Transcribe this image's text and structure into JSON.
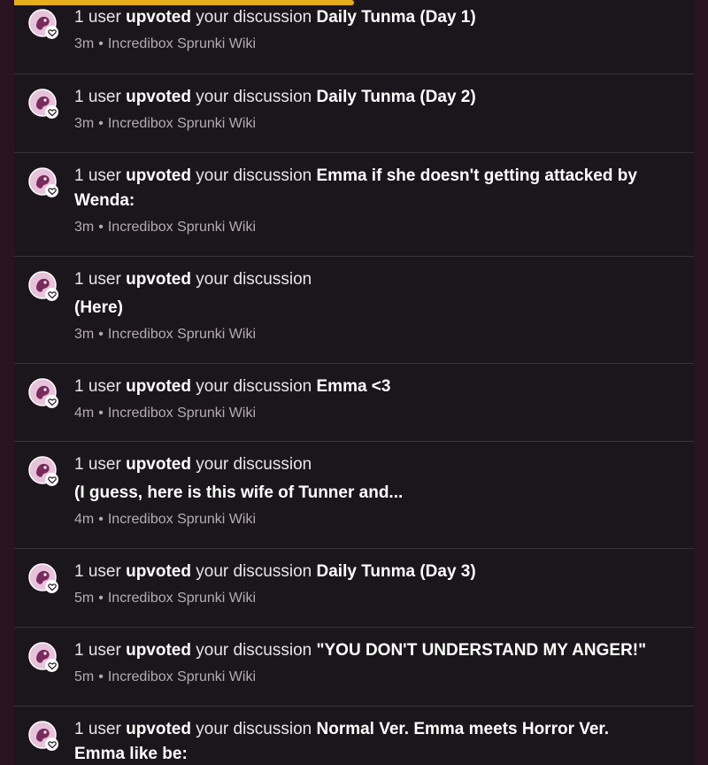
{
  "colors": {
    "background": "#2a1320",
    "panel": "#1b161b",
    "divider": "#3a3339",
    "progress": "#e6ad1c",
    "avatar_bg": "#e6c3da",
    "avatar_fg": "#7a2a5c"
  },
  "progress": {
    "fraction": 0.5
  },
  "notifications": [
    {
      "count": "1 user",
      "action": "upvoted",
      "middle": "your discussion",
      "title": "Daily Tunma (Day 1)",
      "title_on_new_line": false,
      "time": "3m",
      "separator": "•",
      "source": "Incredibox Sprunki Wiki"
    },
    {
      "count": "1 user",
      "action": "upvoted",
      "middle": "your discussion",
      "title": "Daily Tunma (Day 2)",
      "title_on_new_line": false,
      "time": "3m",
      "separator": "•",
      "source": "Incredibox Sprunki Wiki"
    },
    {
      "count": "1 user",
      "action": "upvoted",
      "middle": "your discussion",
      "title": "Emma if she doesn't getting attacked by Wenda:",
      "title_on_new_line": false,
      "time": "3m",
      "separator": "•",
      "source": "Incredibox Sprunki Wiki"
    },
    {
      "count": "1 user",
      "action": "upvoted",
      "middle": "your discussion",
      "title": "(Here)",
      "title_on_new_line": true,
      "time": "3m",
      "separator": "•",
      "source": "Incredibox Sprunki Wiki"
    },
    {
      "count": "1 user",
      "action": "upvoted",
      "middle": "your discussion",
      "title": "Emma <3",
      "title_on_new_line": false,
      "time": "4m",
      "separator": "•",
      "source": "Incredibox Sprunki Wiki"
    },
    {
      "count": "1 user",
      "action": "upvoted",
      "middle": "your discussion",
      "title": "(I guess, here is this wife of Tunner and...",
      "title_on_new_line": true,
      "time": "4m",
      "separator": "•",
      "source": "Incredibox Sprunki Wiki"
    },
    {
      "count": "1 user",
      "action": "upvoted",
      "middle": "your discussion",
      "title": "Daily Tunma (Day 3)",
      "title_on_new_line": false,
      "time": "5m",
      "separator": "•",
      "source": "Incredibox Sprunki Wiki"
    },
    {
      "count": "1 user",
      "action": "upvoted",
      "middle": "your discussion",
      "title": "\"YOU DON'T UNDERSTAND MY ANGER!\"",
      "title_on_new_line": false,
      "time": "5m",
      "separator": "•",
      "source": "Incredibox Sprunki Wiki"
    },
    {
      "count": "1 user",
      "action": "upvoted",
      "middle": "your discussion",
      "title": "Normal Ver. Emma meets Horror Ver. Emma like be:",
      "title_on_new_line": false,
      "time": "",
      "separator": "",
      "source": ""
    }
  ]
}
